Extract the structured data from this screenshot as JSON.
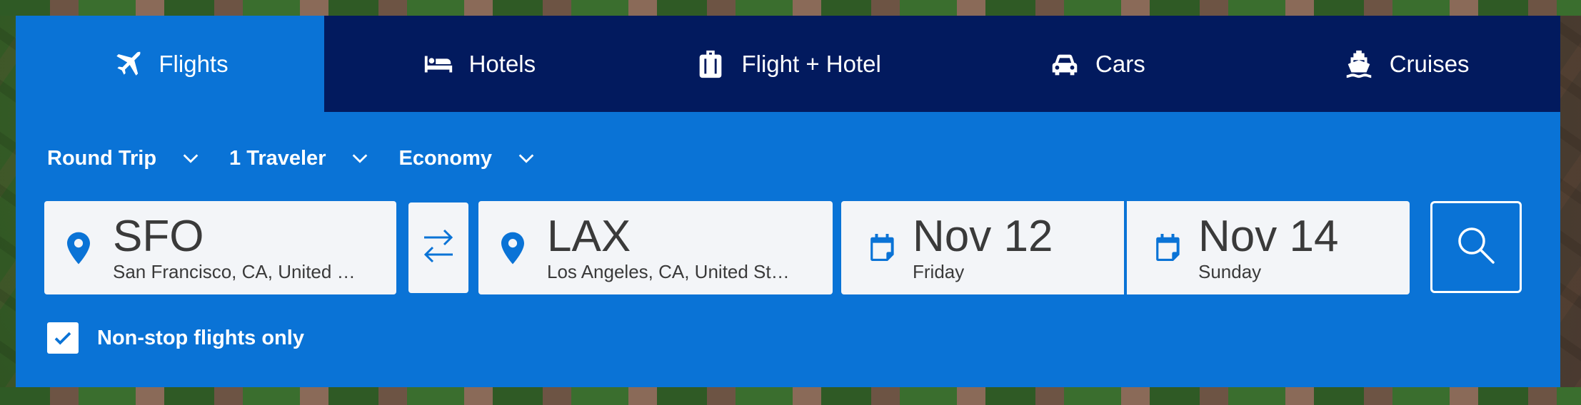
{
  "tabs": [
    {
      "label": "Flights",
      "icon": "plane-icon",
      "active": true
    },
    {
      "label": "Hotels",
      "icon": "bed-icon",
      "active": false
    },
    {
      "label": "Flight + Hotel",
      "icon": "luggage-icon",
      "active": false
    },
    {
      "label": "Cars",
      "icon": "car-icon",
      "active": false
    },
    {
      "label": "Cruises",
      "icon": "ship-icon",
      "active": false
    }
  ],
  "options": {
    "trip_type": "Round Trip",
    "travelers": "1 Traveler",
    "cabin": "Economy"
  },
  "origin": {
    "code": "SFO",
    "city": "San Francisco, CA, United …"
  },
  "destination": {
    "code": "LAX",
    "city": "Los Angeles, CA, United St…"
  },
  "depart": {
    "date": "Nov 12",
    "day": "Friday"
  },
  "return": {
    "date": "Nov 14",
    "day": "Sunday"
  },
  "nonstop": {
    "label": "Non-stop flights only",
    "checked": true
  },
  "colors": {
    "primary": "#0a73d6",
    "tab_bar": "#021a5e",
    "field_bg": "#f3f5f8",
    "text": "#3a3a3a"
  }
}
